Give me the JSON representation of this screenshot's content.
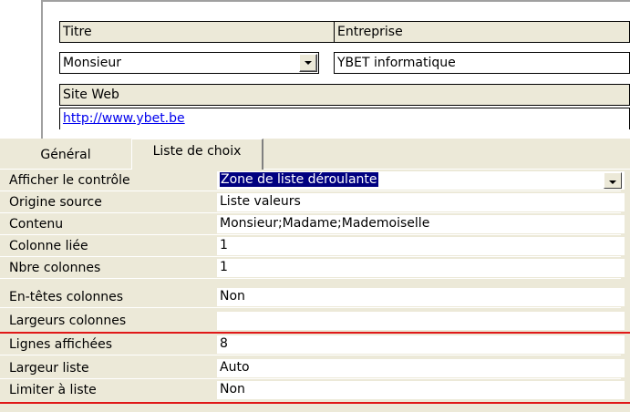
{
  "form": {
    "titre_label": "Titre",
    "entreprise_label": "Entreprise",
    "titre_value": "Monsieur",
    "entreprise_value": "YBET informatique",
    "siteweb_label": "Site Web",
    "siteweb_value": "http://www.ybet.be"
  },
  "tabs": {
    "general": "Général",
    "liste_choix": "Liste de choix"
  },
  "properties": [
    {
      "label": "Afficher le contrôle",
      "value": "Zone de liste déroulante"
    },
    {
      "label": "Origine source",
      "value": "Liste valeurs"
    },
    {
      "label": "Contenu",
      "value": "Monsieur;Madame;Mademoiselle"
    },
    {
      "label": "Colonne liée",
      "value": "1"
    },
    {
      "label": "Nbre colonnes",
      "value": "1"
    },
    {
      "label": "En-têtes colonnes",
      "value": "Non"
    },
    {
      "label": "Largeurs colonnes",
      "value": ""
    },
    {
      "label": "Lignes affichées",
      "value": "8"
    },
    {
      "label": "Largeur liste",
      "value": "Auto"
    },
    {
      "label": "Limiter à liste",
      "value": "Non"
    }
  ],
  "colors": {
    "highlight": "#e01818",
    "selection": "#000080",
    "link": "#0000ee",
    "panel": "#ece9d8"
  }
}
